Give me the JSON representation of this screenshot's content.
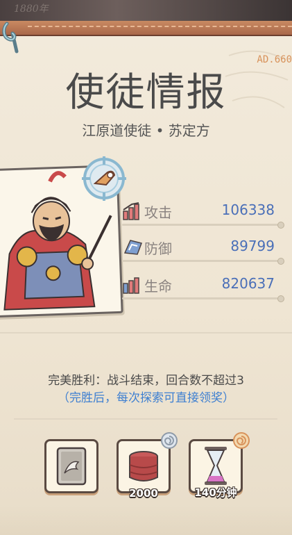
{
  "top_strip_text": "1880年",
  "corner_tag": "AD.660",
  "title": "使徒情报",
  "subtitle": "江原道使徒 • 苏定方",
  "stats": [
    {
      "icon": "attack-icon",
      "label": "攻击",
      "value": "106338"
    },
    {
      "icon": "defense-icon",
      "label": "防御",
      "value": "89799"
    },
    {
      "icon": "health-icon",
      "label": "生命",
      "value": "820637"
    }
  ],
  "condition": "完美胜利：战斗结束，回合数不超过3",
  "condition_note": "（完胜后，每次探索可直接领奖）",
  "rewards": [
    {
      "icon": "card-icon",
      "count": ""
    },
    {
      "icon": "drum-icon",
      "count": "2000"
    },
    {
      "icon": "hourglass-icon",
      "count": "140分钟"
    }
  ],
  "colors": {
    "paper": "#f2eadb",
    "stat_value": "#4a6fb8",
    "note": "#3d7fd1",
    "accent": "#d8925a"
  }
}
